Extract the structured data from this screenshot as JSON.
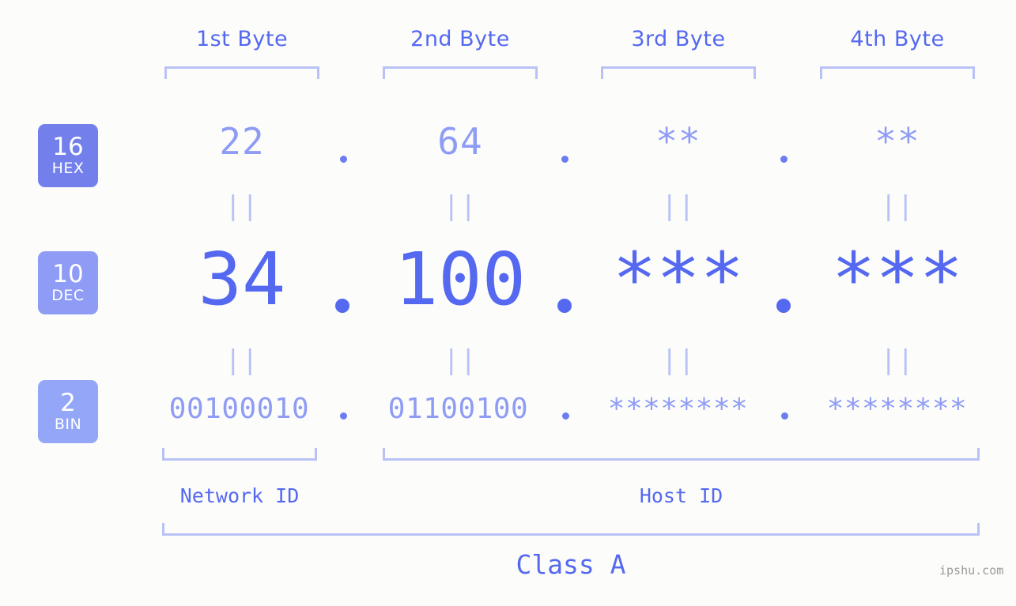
{
  "background_color": "#fcfdfa",
  "colors": {
    "primary": "#5568f0",
    "light": "#8f9cf5",
    "bracket": "#b9c2f7",
    "badge_hex": "#7380ec",
    "badge_dec": "#8f9cf5",
    "badge_bin": "#94a6f7",
    "watermark": "#9a9a9a"
  },
  "byte_headers": [
    {
      "label": "1st Byte"
    },
    {
      "label": "2nd Byte"
    },
    {
      "label": "3rd Byte"
    },
    {
      "label": "4th Byte"
    }
  ],
  "radix_badges": [
    {
      "number": "16",
      "system": "HEX"
    },
    {
      "number": "10",
      "system": "DEC"
    },
    {
      "number": "2",
      "system": "BIN"
    }
  ],
  "rows": {
    "hex": {
      "values": [
        "22",
        "64",
        "**",
        "**"
      ],
      "separator": "."
    },
    "dec": {
      "values": [
        "34",
        "100",
        "***",
        "***"
      ],
      "separator": "."
    },
    "bin": {
      "values": [
        "00100010",
        "01100100",
        "********",
        "********"
      ],
      "separator": "."
    }
  },
  "equality_mark": "||",
  "segments": {
    "network_id": "Network ID",
    "host_id": "Host ID",
    "class": "Class A"
  },
  "watermark": "ipshu.com"
}
